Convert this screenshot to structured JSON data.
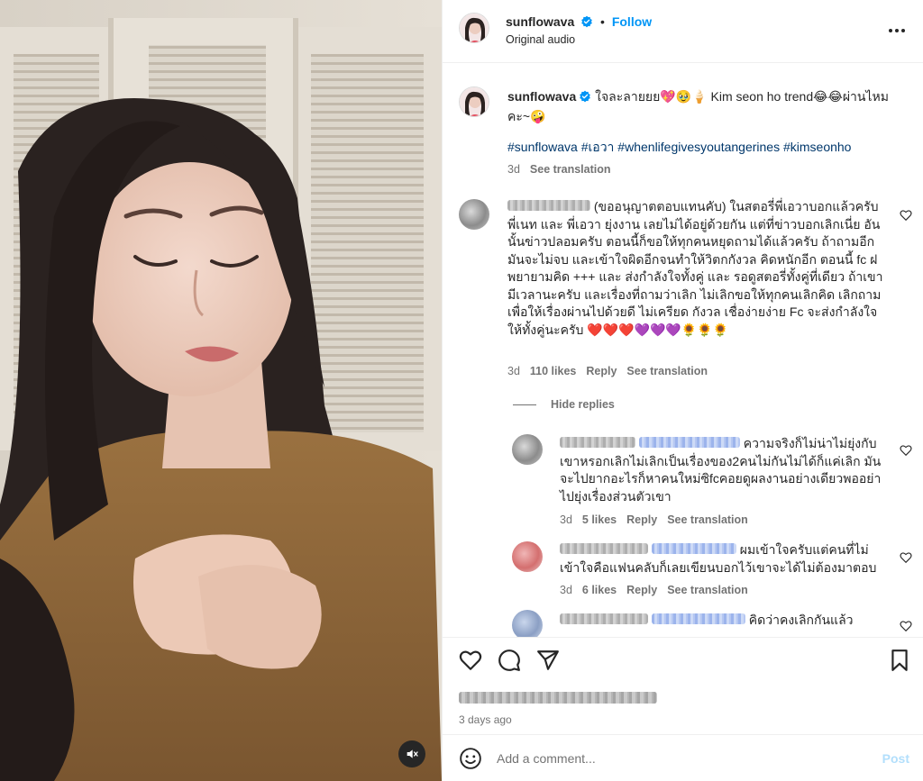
{
  "post": {
    "username": "sunflowava",
    "follow_label": "Follow",
    "audio": "Original audio",
    "muted": true
  },
  "caption": {
    "username": "sunflowava",
    "text": "ใจละลายยย💖🥹🍦 Kim seon ho trend😂😂ผ่านไหมคะ~🤪",
    "hashtags": "#sunflowava #เอวา #whenlifegivesyoutangerines #kimseonho",
    "age": "3d",
    "see_translation": "See translation"
  },
  "comments": [
    {
      "text": "(ขออนุญาตตอบแทนคับ) ในสตอรี่พี่เอวาบอกแล้วครับ พี่เนท และ พี่เอวา ยุ่งงาน เลยไม่ได้อยู่ด้วยกัน แต่ที่ข่าวบอกเลิกเนี่ย อันนั้นข่าวปลอมครับ ตอนนี้ก็ขอให้ทุกคนหยุดถามได้แล้วครับ ถ้าถามอีก มันจะไม่จบ และเข้าใจผิดอีกจนทำให้วิตกกังวล คิดหนักอีก ตอนนี้ fc ฝ พยายามคิด +++ และ ส่งกำลังใจทั้งคู่ และ รอดูสตอรี่ทั้งคู่ที่เดียว ถ้าเขามีเวลานะครับ และเรื่องที่ถามว่าเลิก ไม่เลิกขอให้ทุกคนเลิกคิด เลิกถาม เพื่อให้เรื่องผ่านไปด้วยดี ไม่เครียด กังวล เชื่อง่ายง่าย Fc จะส่งกำลังใจให้ทั้งคู่นะครับ ❤️❤️❤️💜💜💜🌻🌻🌻",
      "age": "3d",
      "likes": "110 likes",
      "reply": "Reply",
      "see_translation": "See translation"
    }
  ],
  "hide_replies": "Hide replies",
  "replies": [
    {
      "text": "ความจริงก็ไม่น่าไม่ยุ่งกับเขาหรอกเลิกไม่เลิกเป็นเรื่องของ2คนไม่กันไม่ได้ก็แค่เลิก มันจะไปยากอะไรก็หาคนใหม่ซิfcคอยดูผลงานอย่างเดียวพออย่าไปยุ่งเรื่องส่วนตัวเขา",
      "age": "3d",
      "likes": "5 likes",
      "reply": "Reply",
      "see_translation": "See translation"
    },
    {
      "text": "ผมเข้าใจครับแต่คนที่ไม่เข้าใจคือแฟนคลับก็เลยเขียนบอกไว้เขาจะได้ไม่ต้องมาตอบ",
      "age": "3d",
      "likes": "6 likes",
      "reply": "Reply",
      "see_translation": "See translation"
    },
    {
      "text": "คิดว่าคงเลิกกันแล้ว"
    }
  ],
  "footer": {
    "date": "3 days ago",
    "comment_placeholder": "Add a comment...",
    "post_label": "Post"
  },
  "colors": {
    "link_blue": "#0095f6",
    "hashtag": "#00376b",
    "muted_text": "#737373",
    "post_disabled": "#b2dffc"
  },
  "icons": [
    "verified-badge-icon",
    "more-options-icon",
    "heart-icon",
    "comment-icon",
    "share-icon",
    "bookmark-icon",
    "emoji-icon",
    "mute-icon"
  ]
}
